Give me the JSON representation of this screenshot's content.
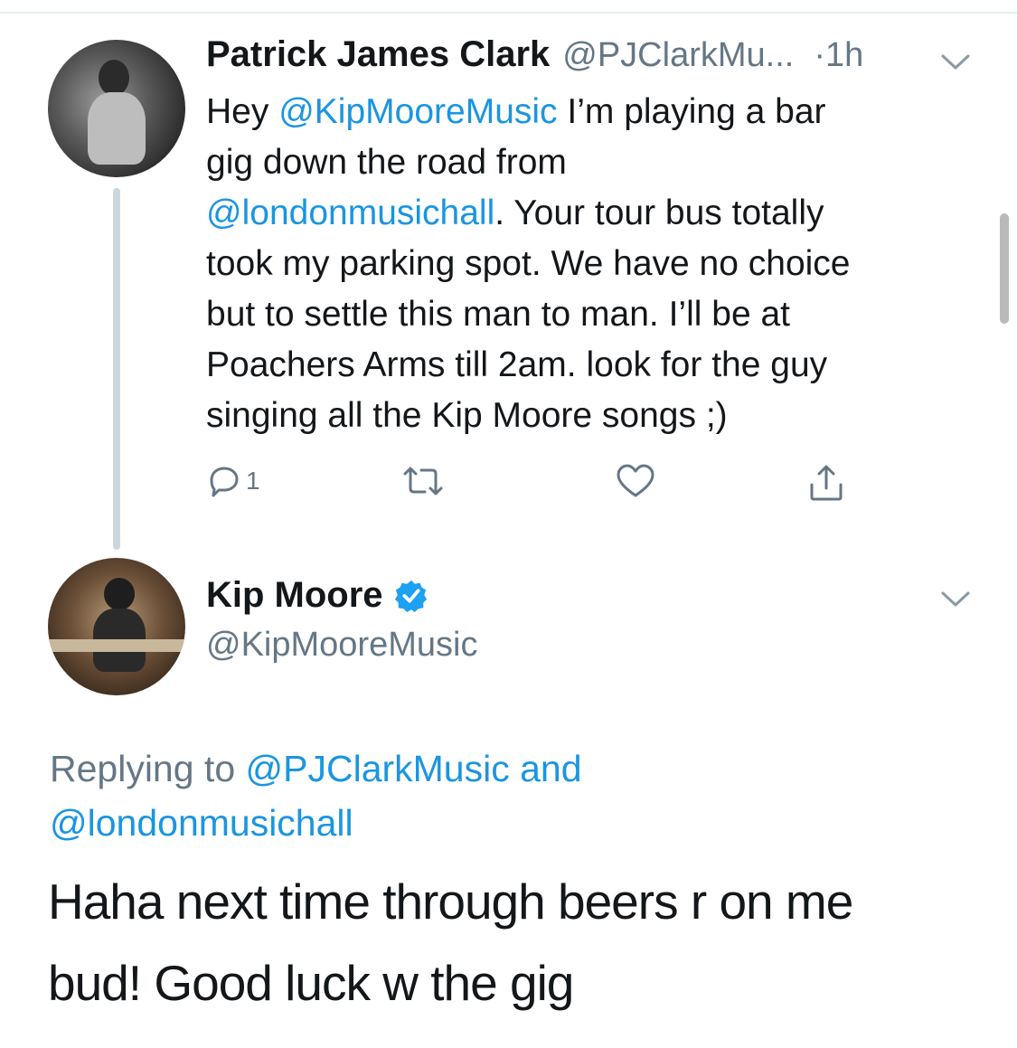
{
  "tweet1": {
    "display_name": "Patrick James Clark",
    "handle": "@PJClarkMu...",
    "separator": "·",
    "time": "1h",
    "body": {
      "line1_prefix": "Hey ",
      "line1_mention": "@KipMooreMusic",
      "line1_suffix": " I’m playing a bar",
      "line2": "gig down the road from",
      "line3_mention": "@londonmusichall",
      "line3_suffix": ". Your tour bus totally",
      "line4": "took my parking spot. We have no choice",
      "line5": "but to settle this man to man. I’ll be at",
      "line6": "Poachers Arms till 2am. look for the guy",
      "line7": "singing all the Kip Moore songs ;)"
    },
    "reply_count": "1",
    "icons": [
      "reply-icon",
      "retweet-icon",
      "like-icon",
      "share-icon",
      "chevron-down-icon"
    ]
  },
  "tweet2": {
    "display_name": "Kip Moore",
    "handle": "@KipMooreMusic",
    "replying_prefix": "Replying to ",
    "replying_mention1": "@PJClarkMusic",
    "replying_and": " and",
    "replying_mention2": "@londonmusichall",
    "body_line1": "Haha next time through beers r on me",
    "body_line2": "bud! Good luck w the gig",
    "icons": [
      "verified-badge-icon",
      "chevron-down-icon"
    ]
  },
  "colors": {
    "link": "#1b95e0",
    "secondary_text": "#657786",
    "primary_text": "#14171a",
    "verified": "#1da1f2",
    "thread_line": "#ccd6dd"
  }
}
